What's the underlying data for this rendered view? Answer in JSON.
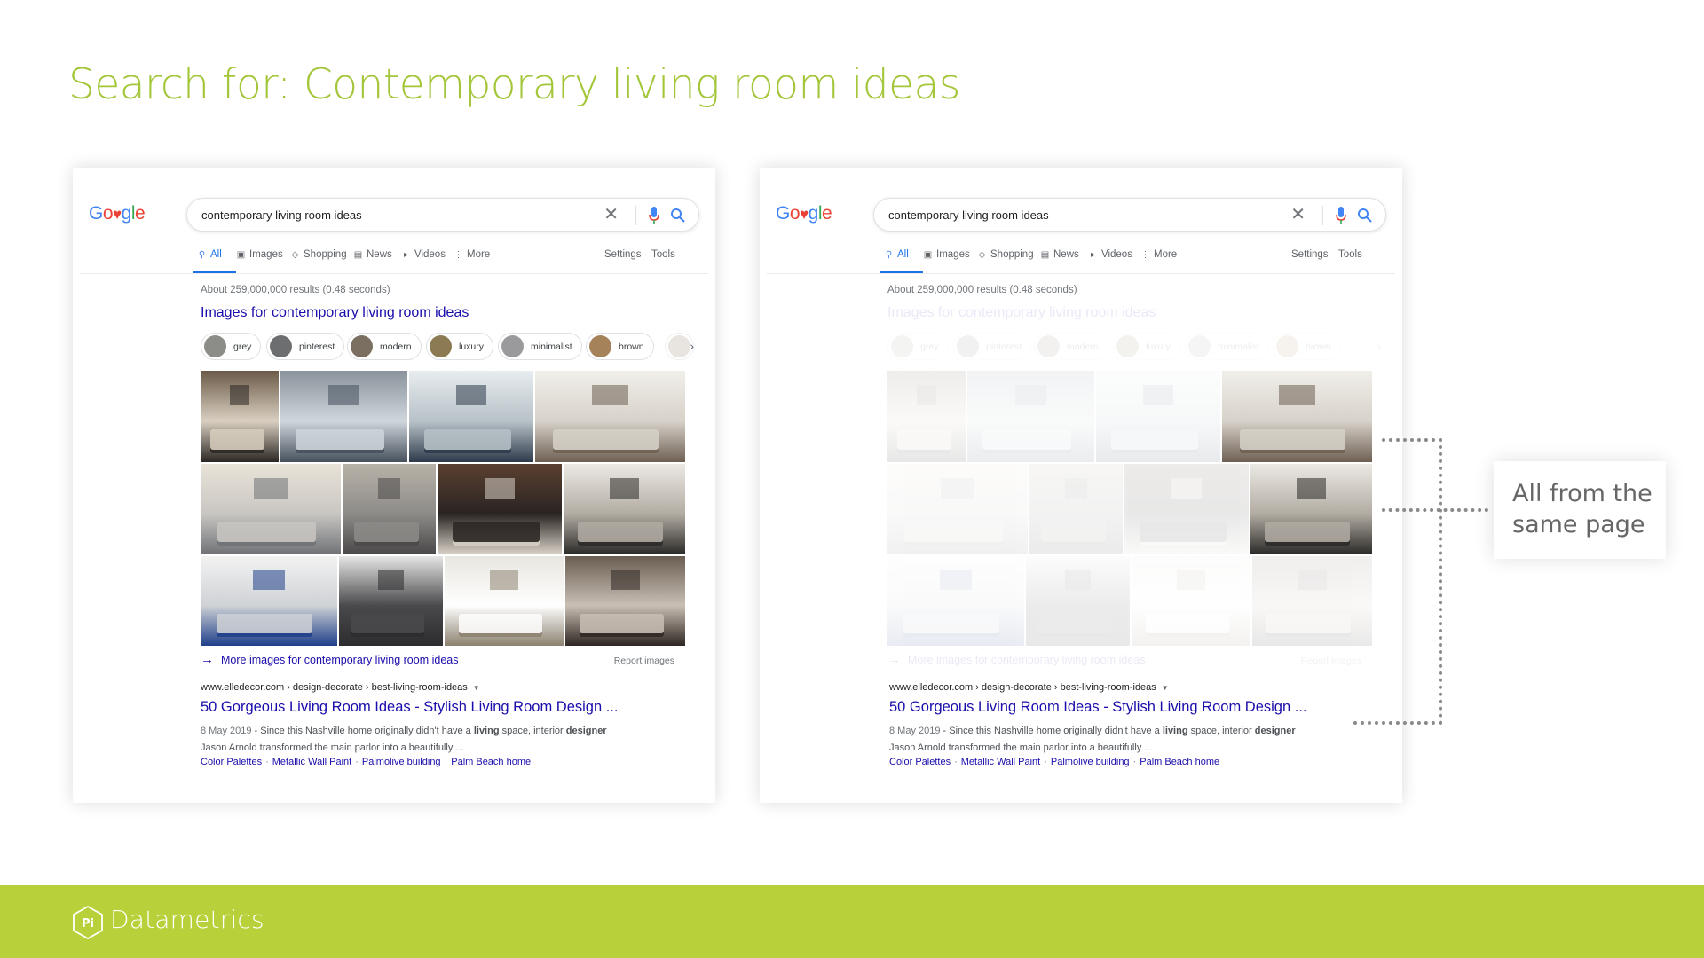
{
  "slide": {
    "title": "Search for: Contemporary living room ideas",
    "callout": {
      "line1": "All from the",
      "line2": "same page"
    },
    "footer_brand": "Datametrics",
    "colors": {
      "accent": "#a3c639",
      "footer": "#b8d13a",
      "callout_text": "#666666",
      "dots": "#8a8a8a"
    }
  },
  "serp": {
    "logo": {
      "letters": [
        "G",
        "o",
        "♥",
        "g",
        "l",
        "e"
      ]
    },
    "query": "contemporary living room ideas",
    "clear_icon": "close-icon",
    "tabs": [
      {
        "label": "All",
        "icon": "search-icon",
        "active": true
      },
      {
        "label": "Images",
        "icon": "image-icon"
      },
      {
        "label": "Shopping",
        "icon": "tag-icon"
      },
      {
        "label": "News",
        "icon": "news-icon"
      },
      {
        "label": "Videos",
        "icon": "play-icon"
      },
      {
        "label": "More",
        "icon": "more-vertical-icon"
      }
    ],
    "settings_label": "Settings",
    "tools_label": "Tools",
    "result_stats": "About 259,000,000 results (0.48 seconds)",
    "images_heading": "Images for contemporary living room ideas",
    "chips": [
      {
        "label": "grey",
        "color": "#8c8c88"
      },
      {
        "label": "pinterest",
        "color": "#6d6e70"
      },
      {
        "label": "modern",
        "color": "#7a6f60"
      },
      {
        "label": "luxury",
        "color": "#8b7a52"
      },
      {
        "label": "minimalist",
        "color": "#9a9a9c"
      },
      {
        "label": "brown",
        "color": "#a5825a"
      }
    ],
    "more_images": "More images for contemporary living room ideas",
    "report_images": "Report images",
    "result": {
      "url": "www.elledecor.com › design-decorate › best-living-room-ideas",
      "title": "50 Gorgeous Living Room Ideas - Stylish Living Room Design ...",
      "date": "8 May 2019",
      "snippet_a": " - Since this Nashville home originally didn't have a ",
      "snippet_b1": "living",
      "snippet_c": " space, interior ",
      "snippet_b2": "designer",
      "snippet_line2": "Jason Arnold transformed the main parlor into a beautifully ...",
      "links": [
        "Color Palettes",
        "Metallic Wall Paint",
        "Palmolive building",
        "Palm Beach home"
      ]
    },
    "image_tiles": [
      {
        "row": 0,
        "colors": [
          "#6b5a48",
          "#d9cfc0",
          "#2a2622"
        ],
        "highlight": false
      },
      {
        "row": 0,
        "colors": [
          "#8a929b",
          "#cfd6dc",
          "#46505c"
        ],
        "highlight": false
      },
      {
        "row": 0,
        "colors": [
          "#e7ecef",
          "#b8c2c8",
          "#2d3a4a"
        ],
        "highlight": false
      },
      {
        "row": 0,
        "colors": [
          "#f1efea",
          "#d7d2ca",
          "#6e5f52"
        ],
        "highlight": true
      },
      {
        "row": 1,
        "colors": [
          "#e9e3d8",
          "#c9c6c2",
          "#6f7276"
        ],
        "highlight": false
      },
      {
        "row": 1,
        "colors": [
          "#b8b2a8",
          "#8d8b88",
          "#4a4848"
        ],
        "highlight": false
      },
      {
        "row": 1,
        "colors": [
          "#5a4030",
          "#2a2422",
          "#d8d2c8"
        ],
        "highlight": false
      },
      {
        "row": 1,
        "colors": [
          "#ece9e4",
          "#b2aca3",
          "#2b2a28"
        ],
        "highlight": true
      },
      {
        "row": 2,
        "colors": [
          "#f2f2f2",
          "#cfd2d6",
          "#1f3f8a"
        ],
        "highlight": false
      },
      {
        "row": 2,
        "colors": [
          "#e6e6e6",
          "#4a4a4c",
          "#2c2c2e"
        ],
        "highlight": false
      },
      {
        "row": 2,
        "colors": [
          "#e8e6e0",
          "#ffffff",
          "#8c8270"
        ],
        "highlight": false
      },
      {
        "row": 2,
        "colors": [
          "#6a5d52",
          "#c9bfb4",
          "#2e2622"
        ],
        "highlight": false
      }
    ]
  }
}
